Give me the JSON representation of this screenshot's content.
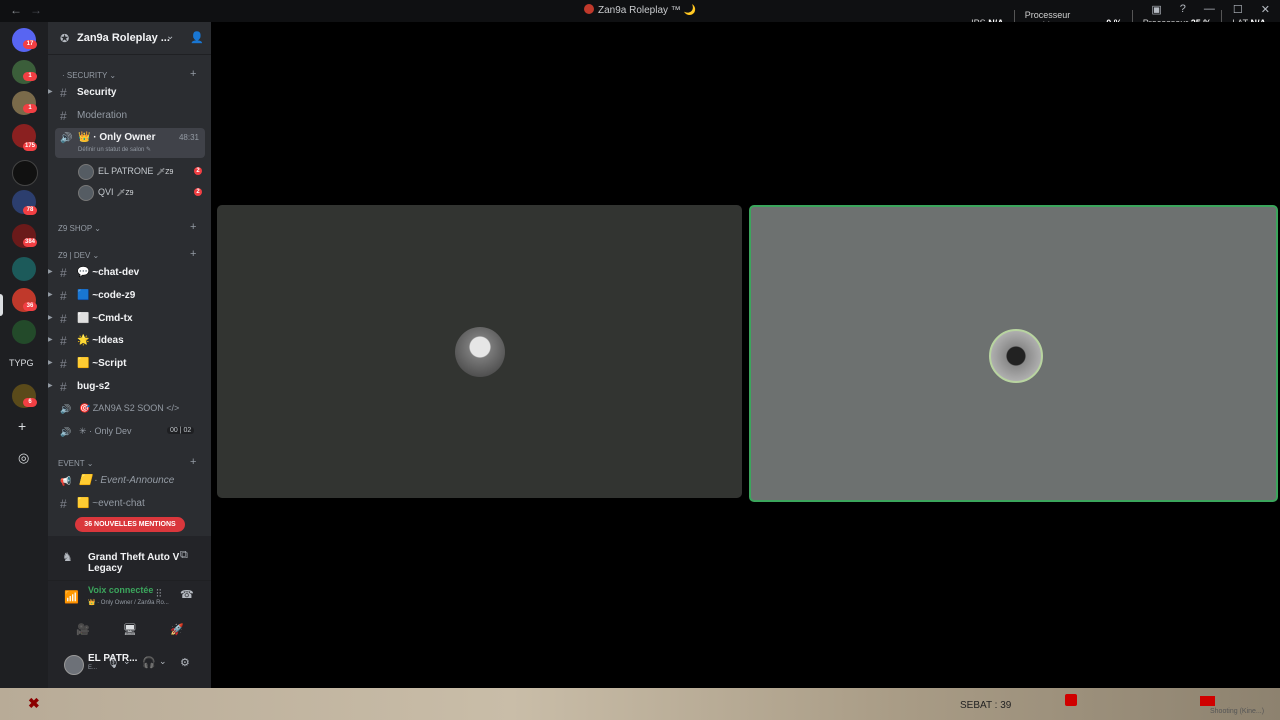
{
  "window": {
    "title": "Zan9a Roleplay ™ 🌙",
    "back": "←",
    "forward": "→"
  },
  "titlebar_icons": [
    "inbox-icon",
    "help-icon",
    "minimize-icon",
    "maximize-icon",
    "close-icon"
  ],
  "titlebar_glyphs": {
    "inbox": "▣",
    "help": "?",
    "minimize": "—",
    "maximize": "☐",
    "close": "✕"
  },
  "perf": {
    "ips_label": "IPS",
    "ips_value": "N/A",
    "gpu_label_1": "Processeur",
    "gpu_label_2": "graphique",
    "gpu_value": "0 %",
    "cpu_label": "Processeur",
    "cpu_value": "25 %",
    "lat_label": "LAT",
    "lat_value": "N/A"
  },
  "rail": {
    "badges": [
      "17",
      "1",
      "1",
      "175",
      "78",
      "384",
      "36",
      "6"
    ],
    "text_item": "TYPG",
    "add_glyph": "+",
    "explore_glyph": "◎"
  },
  "server": {
    "name": "Zan9a Roleplay ...",
    "chevron": "⌄",
    "invite_glyph": "👤"
  },
  "sidebar": {
    "cat_security": "· Security ⌄",
    "ch_security": "Security",
    "ch_moderation": "Moderation",
    "voice_only_owner": "👑 · Only Owner",
    "voice_only_owner_status": "Définir un statut de salon ✎",
    "voice_only_owner_time": "48:31",
    "users": [
      {
        "name": "EL PATRONE",
        "tag": "🗡Z9",
        "badge": "2"
      },
      {
        "name": "QVI",
        "tag": "🗡Z9",
        "badge": "2"
      }
    ],
    "cat_shop": "Z9 SHOP ⌄",
    "cat_dev": "Z9 | DEV ⌄",
    "ch_chat_dev": "💬 ~chat-dev",
    "ch_code_z9": "🟦 ~code-z9",
    "ch_cmd_tx": "⬜ ~Cmd-tx",
    "ch_ideas": "🌟 ~Ideas",
    "ch_script": "🟨 ~Script",
    "ch_bug": "bug-s2",
    "voice_zan9a": "🎯 ZAN9A S2 SOON </>",
    "voice_only_dev": "✳ · Only Dev",
    "only_dev_counts": "00 | 02",
    "cat_event": "EVENT ⌄",
    "ch_event_announce": "🟨 · Event-Announce",
    "ch_event_chat": "🟨 ~event-chat",
    "mentions": "36 NOUVELLES MENTIONS",
    "plus": "+",
    "hash": "#",
    "speaker": "🔊",
    "arrow": "▶"
  },
  "activity": {
    "game": "Grand Theft Auto V Legacy",
    "game_glyph": "♞",
    "screen_glyph": "⧉"
  },
  "voice_panel": {
    "status": "Voix connectée",
    "channel": "👑 · Only Owner / Zan9a Ro...",
    "signal_glyph": "📶",
    "wave_glyph": "⫶⫶",
    "hangup_glyph": "☎",
    "buttons": [
      "🎥",
      "🖥",
      "🚀",
      "🎉"
    ]
  },
  "user_panel": {
    "name": "EL PATR...",
    "status": "E...",
    "mic_glyph": "🎙",
    "headset_glyph": "🎧",
    "settings_glyph": "⚙",
    "chevron": "⌄"
  },
  "stage": {
    "tiles": [
      "participant-1",
      "participant-2"
    ]
  },
  "game_hud": {
    "close_glyph": "✖",
    "sebat": "SEBAT : 39",
    "watermark": "Shooting (Kine...)"
  },
  "colors": {
    "accent_green": "#3ba55c",
    "mention_red": "#da373c",
    "badge_red": "#f23f43"
  }
}
